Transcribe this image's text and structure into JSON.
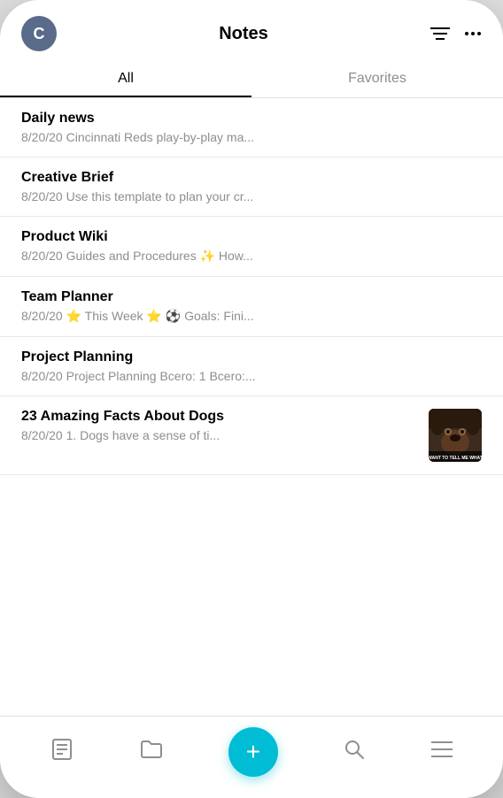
{
  "header": {
    "avatar_letter": "C",
    "title": "Notes",
    "filter_icon": "≡",
    "more_icon": "···"
  },
  "tabs": [
    {
      "label": "All",
      "active": true
    },
    {
      "label": "Favorites",
      "active": false
    }
  ],
  "notes": [
    {
      "id": 1,
      "title": "Daily news",
      "preview": "8/20/20 Cincinnati Reds play-by-play ma...",
      "has_thumbnail": false
    },
    {
      "id": 2,
      "title": "Creative Brief",
      "preview": "8/20/20 Use this template to plan your cr...",
      "has_thumbnail": false
    },
    {
      "id": 3,
      "title": "Product Wiki",
      "preview": "8/20/20 Guides and Procedures ✨ How...",
      "has_thumbnail": false
    },
    {
      "id": 4,
      "title": "Team Planner",
      "preview": "8/20/20 ⭐ This Week ⭐ ⚽ Goals: Fini...",
      "has_thumbnail": false
    },
    {
      "id": 5,
      "title": "Project Planning",
      "preview": "8/20/20 Project Planning  Bcero: 1 Bcero:...",
      "has_thumbnail": false
    },
    {
      "id": 6,
      "title": "23 Amazing Facts About Dogs",
      "preview": "8/20/20 1. Dogs have a sense of ti...",
      "has_thumbnail": true
    }
  ],
  "bottom_nav": {
    "notes_label": "notes-icon",
    "folder_label": "folder-icon",
    "add_label": "+",
    "search_label": "search-icon",
    "menu_label": "menu-icon"
  }
}
